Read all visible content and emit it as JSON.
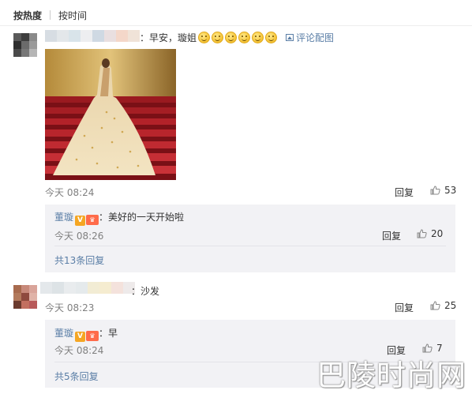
{
  "tabs": {
    "hot": "按热度",
    "time": "按时间"
  },
  "comment1": {
    "text": "：早安，璇姐",
    "emoji_count": 6,
    "pic_link": "评论配图",
    "time": "今天 08:24",
    "reply_label": "回复",
    "likes": "53",
    "reply": {
      "name": "董璇",
      "v_badge": "V",
      "member_badge": "♛",
      "text": "：美好的一天开始啦",
      "time": "今天 08:26",
      "reply_label": "回复",
      "likes": "20"
    },
    "total_replies": "共13条回复"
  },
  "comment2": {
    "text": "：沙发",
    "time": "今天 08:23",
    "reply_label": "回复",
    "likes": "25",
    "reply": {
      "name": "董璇",
      "v_badge": "V",
      "member_badge": "♛",
      "text": "：早",
      "time": "今天 08:24",
      "reply_label": "回复",
      "likes": "7"
    },
    "total_replies": "共5条回复"
  },
  "watermark": "巴陵时尚网",
  "colors": {
    "link": "#5a7ea6",
    "reply_bg": "#f2f2f5",
    "time": "#808080"
  }
}
